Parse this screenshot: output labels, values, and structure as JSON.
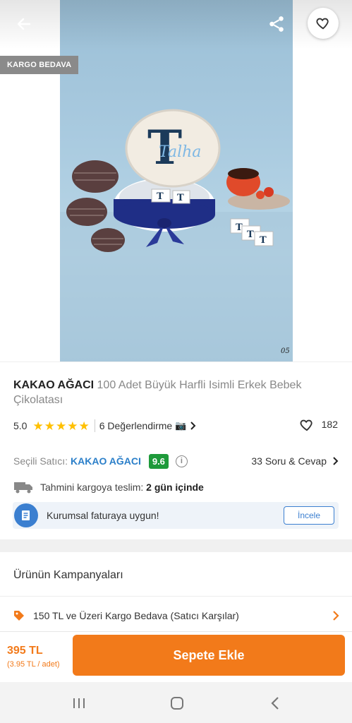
{
  "hero": {
    "badge": "KARGO BEDAVA",
    "photo_code": "05",
    "photo_monogram": "T",
    "photo_script_name": "Talha"
  },
  "product": {
    "brand": "KAKAO AĞACI",
    "name": "100 Adet Büyük Harfli Isimli Erkek Bebek Çikolatası",
    "rating": "5.0",
    "stars": 5,
    "reviews_label": "6 Değerlendirme",
    "favorites_count": "182"
  },
  "seller": {
    "label": "Seçili Satıcı:",
    "name": "KAKAO AĞACI",
    "score": "9.6",
    "qa_label": "33 Soru & Cevap"
  },
  "delivery": {
    "label": "Tahmini kargoya teslim:",
    "value": "2 gün içinde"
  },
  "invoice": {
    "text": "Kurumsal faturaya uygun!",
    "button": "İncele"
  },
  "campaigns": {
    "title": "Ürünün Kampanyaları",
    "item": "150 TL ve Üzeri Kargo Bedava (Satıcı Karşılar)"
  },
  "buy": {
    "price": "395 TL",
    "unit_price": "(3.95 TL / adet)",
    "button": "Sepete Ekle"
  },
  "colors": {
    "accent": "#f27a1a",
    "star": "#ffc000",
    "link": "#2b7fc9",
    "score": "#1e9a3a"
  },
  "icons": {
    "back": "arrow-left-icon",
    "share": "share-icon",
    "favorite": "heart-outline-icon",
    "camera": "camera-icon",
    "info": "info-icon",
    "truck": "truck-icon",
    "invoice": "invoice-icon",
    "tag": "tag-icon"
  }
}
